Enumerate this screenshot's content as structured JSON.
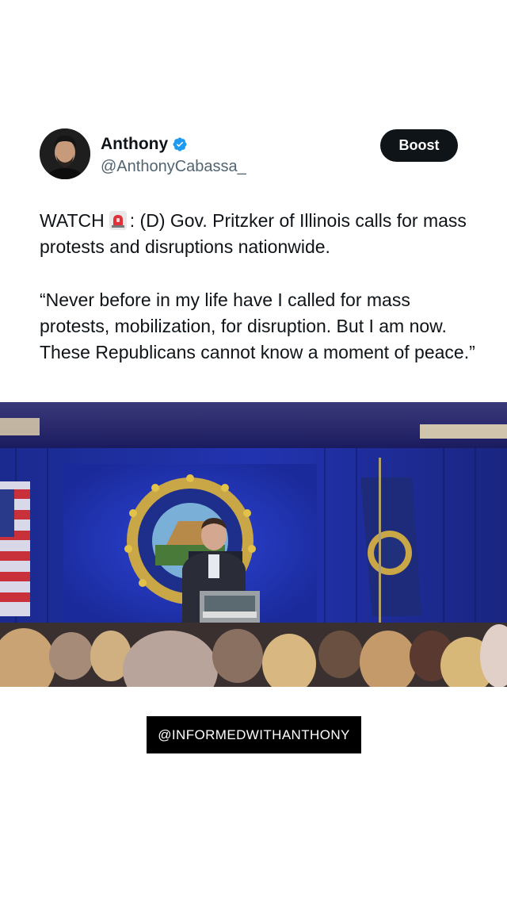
{
  "author": {
    "display_name": "Anthony",
    "handle": "@AnthonyCabassa_",
    "verified": true,
    "avatar_icon": "profile-photo"
  },
  "actions": {
    "boost_label": "Boost"
  },
  "post": {
    "watch_label": "WATCH",
    "emoji_icon": "police-light-icon",
    "headline_rest": ": (D) Gov. Pritzker of Illinois calls for mass protests and disruptions nationwide.",
    "quote": "“Never before in my life have I called for mass protests, mobilization, for disruption. But I am now. These Republicans cannot know a moment of peace.”"
  },
  "media": {
    "type": "video-still"
  },
  "watermark": {
    "text": "@INFORMEDWITHANTHONY"
  },
  "colors": {
    "verified_blue": "#1d9bf0",
    "boost_bg": "#0f1419",
    "handle_gray": "#536471"
  }
}
